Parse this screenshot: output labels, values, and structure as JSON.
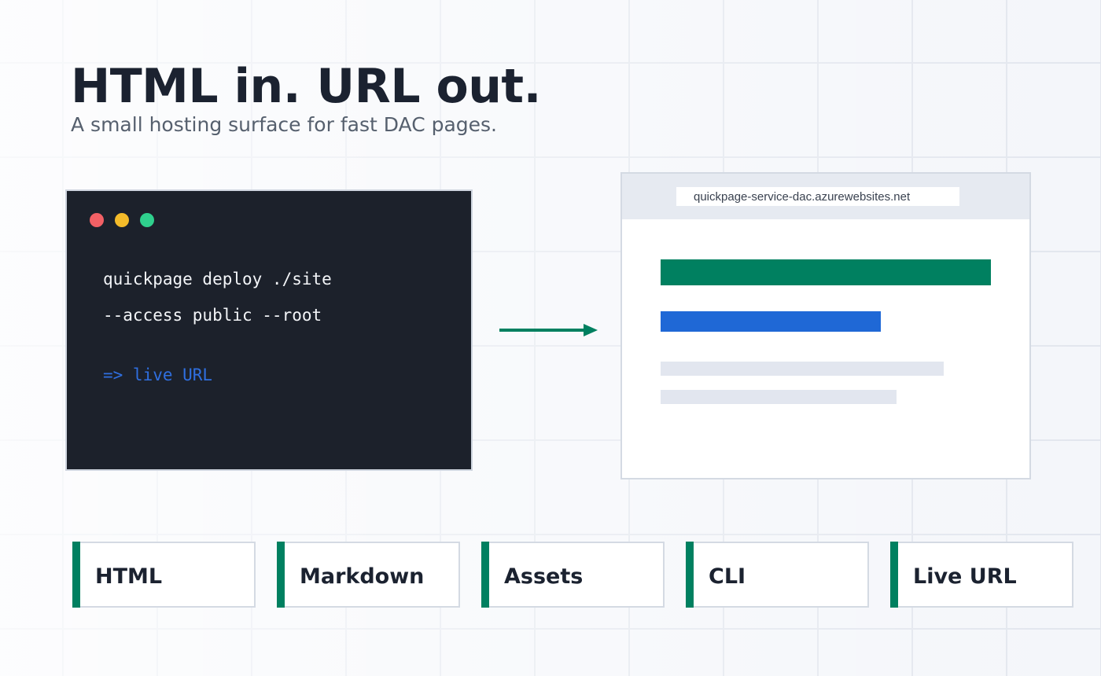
{
  "hero": {
    "title": "HTML in. URL out.",
    "subtitle": "A small hosting surface for fast DAC pages."
  },
  "terminal": {
    "line1": "quickpage deploy ./site",
    "line2": "--access public --root",
    "result": "=> live URL",
    "window_dots": [
      "#f26065",
      "#f4bb2a",
      "#2fd08d"
    ]
  },
  "browser": {
    "url": "quickpage-service-dac.azurewebsites.net"
  },
  "chips": [
    {
      "label": "HTML"
    },
    {
      "label": "Markdown"
    },
    {
      "label": "Assets"
    },
    {
      "label": "CLI"
    },
    {
      "label": "Live URL"
    }
  ],
  "colors": {
    "accent_green": "#008060",
    "accent_blue": "#1f68d6",
    "terminal_bg": "#1c212b",
    "text_dark": "#1b2230"
  }
}
